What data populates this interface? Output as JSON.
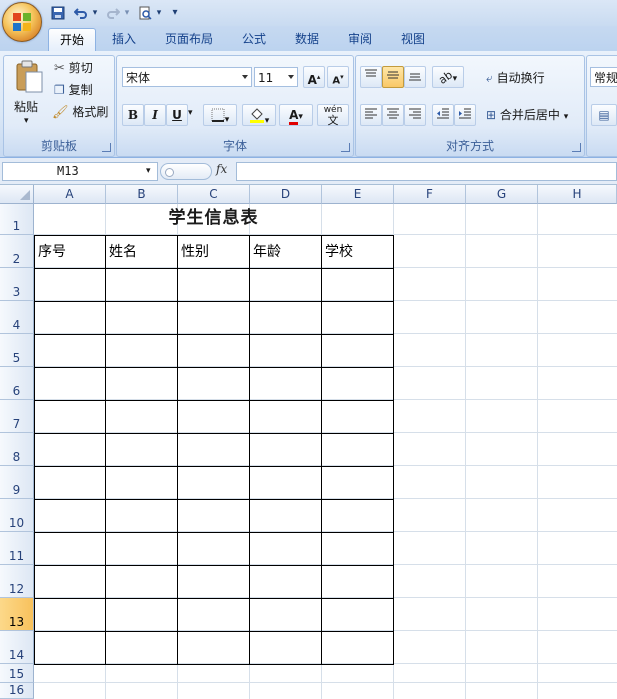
{
  "quick_access": {
    "dropdown_glyph": "▾"
  },
  "tabs": [
    "开始",
    "插入",
    "页面布局",
    "公式",
    "数据",
    "审阅",
    "视图"
  ],
  "clipboard": {
    "paste_label": "粘贴",
    "cut_label": "剪切",
    "copy_label": "复制",
    "format_painter_label": "格式刷",
    "group_label": "剪贴板"
  },
  "font": {
    "family": "宋体",
    "size": "11",
    "grow_label": "A",
    "shrink_label": "A",
    "bold": "B",
    "italic": "I",
    "underline": "U",
    "phonetic_label": "wén",
    "phonetic_char": "文",
    "group_label": "字体"
  },
  "alignment": {
    "wrap_text_label": "自动换行",
    "merge_center_label": "合并后居中",
    "group_label": "对齐方式"
  },
  "number": {
    "format": "常规"
  },
  "formula_bar": {
    "name_box": "M13",
    "fx_label": "fx",
    "formula": ""
  },
  "sheet": {
    "columns": [
      "A",
      "B",
      "C",
      "D",
      "E",
      "F",
      "G",
      "H"
    ],
    "rows": [
      "1",
      "2",
      "3",
      "4",
      "5",
      "6",
      "7",
      "8",
      "9",
      "10",
      "11",
      "12",
      "13",
      "14",
      "15",
      "16"
    ],
    "selected_row": "13",
    "title": "学生信息表",
    "headers": [
      "序号",
      "姓名",
      "性别",
      "年龄",
      "学校"
    ]
  },
  "colors": {
    "accent": "#15428b",
    "ribbon": "#dae7f6",
    "selected_header": "#f8c15c"
  }
}
